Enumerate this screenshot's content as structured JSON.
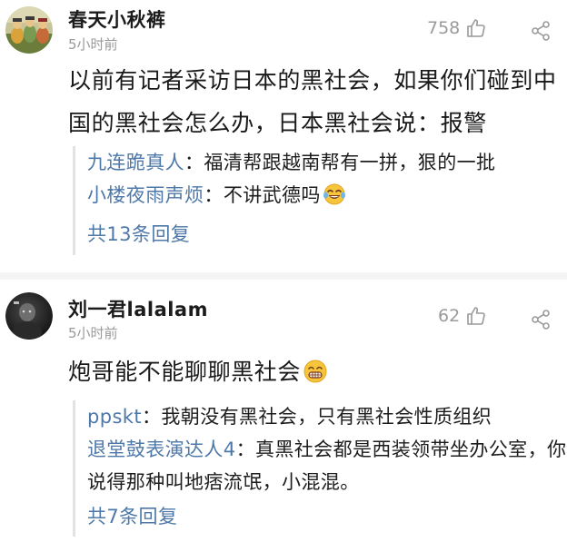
{
  "comments": [
    {
      "username": "春天小秋裤",
      "time": "5小时前",
      "likes": "758",
      "text": "以前有记者采访日本的黑社会，如果你们碰到中国的黑社会怎么办，日本黑社会说：报警",
      "replies": [
        {
          "author": "九连跪真人",
          "text": "福清帮跟越南帮有一拼，狠的一批"
        },
        {
          "author": "小楼夜雨声烦",
          "text": "不讲武德吗"
        }
      ],
      "more_replies": "共13条回复"
    },
    {
      "username": "刘一君lalalam",
      "time": "5小时前",
      "likes": "62",
      "text": "炮哥能不能聊聊黑社会",
      "replies": [
        {
          "author": "ppskt",
          "text": "我朝没有黑社会，只有黑社会性质组织"
        },
        {
          "author": "退堂鼓表演达人4",
          "text": "真黑社会都是西装领带坐办公室，你说得那种叫地痞流氓，小混混。"
        }
      ],
      "more_replies": "共7条回复"
    }
  ],
  "colors": {
    "link": "#4e78a8",
    "muted": "#9a9a9a",
    "text": "#1a1a1a"
  },
  "icons": {
    "like": "thumbs-up-icon",
    "share": "share-icon",
    "emoji_laugh": "laughing-tears-emoji",
    "emoji_grin": "grinning-emoji"
  }
}
